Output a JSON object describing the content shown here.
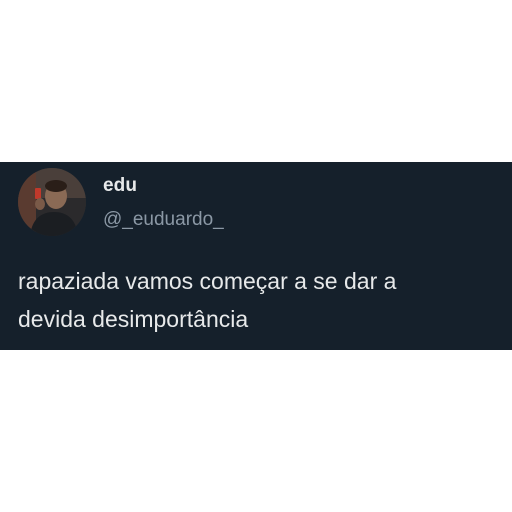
{
  "tweet": {
    "author": {
      "display_name": "edu",
      "handle": "@_euduardo_",
      "avatar_icon": "profile-photo-avatar"
    },
    "text_lines": [
      "rapaziada vamos começar a se dar a",
      "devida desimportância"
    ]
  },
  "colors": {
    "card_background": "#15202b",
    "primary_text": "#e7e9ea",
    "secondary_text": "#8b98a5"
  }
}
